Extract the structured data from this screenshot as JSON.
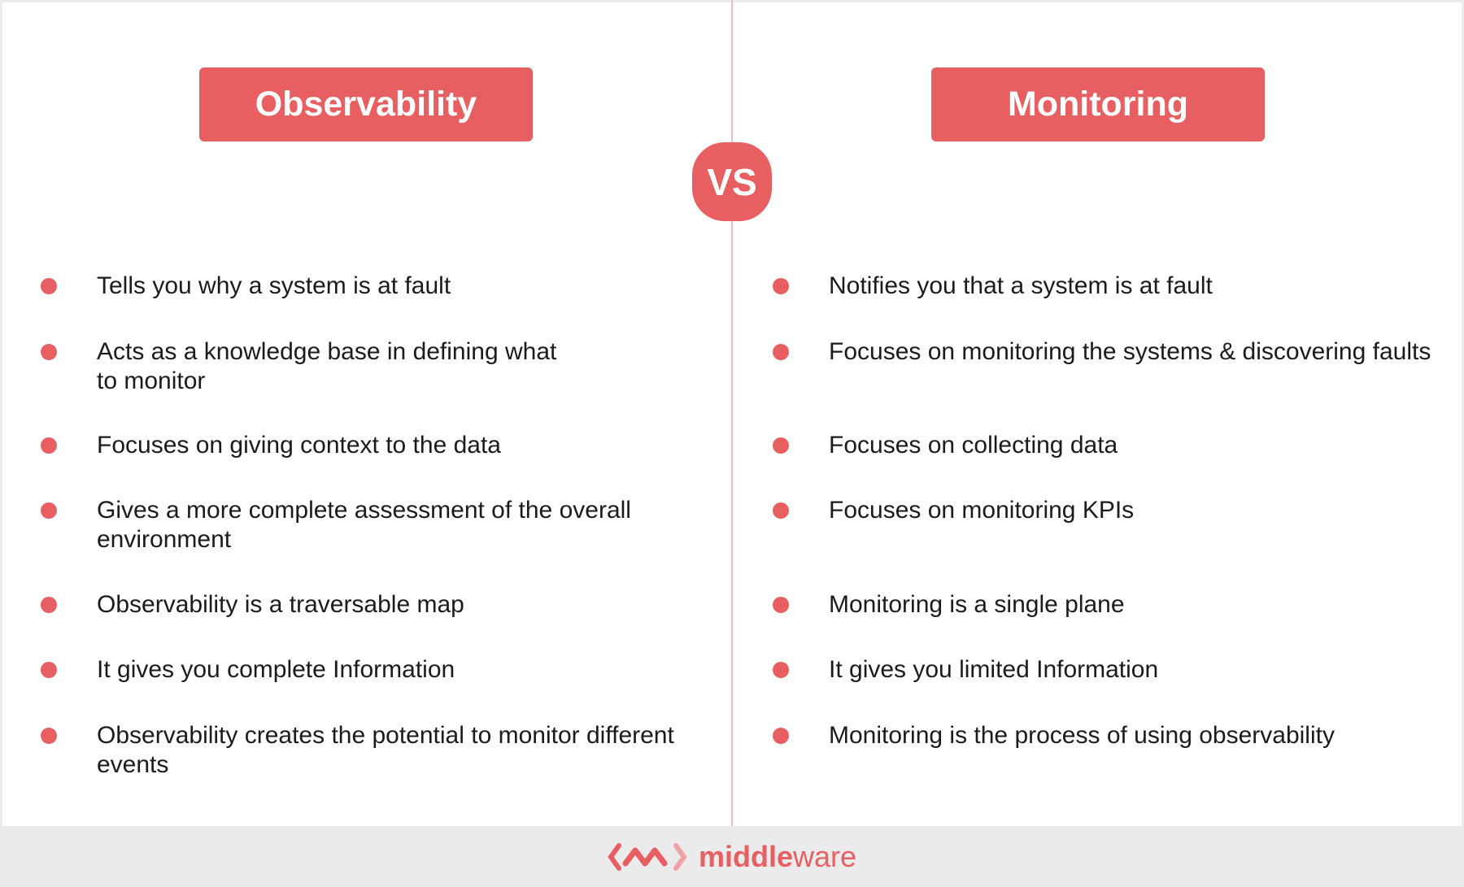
{
  "left": {
    "title": "Observability",
    "items": [
      "Tells you why a system is at fault",
      "Acts as a knowledge base in defining what\nto monitor",
      "Focuses on giving context to the data",
      "Gives a more complete assessment of the overall environment",
      "Observability is a traversable map",
      "It gives you complete Information",
      "Observability creates the potential to monitor different events"
    ]
  },
  "right": {
    "title": "Monitoring",
    "items": [
      "Notifies you that a system is at fault",
      "Focuses on monitoring the systems & discovering faults",
      "Focuses on collecting data",
      "Focuses on monitoring KPIs",
      "Monitoring is a single plane",
      "It gives you limited Information",
      "Monitoring is the process of using observability"
    ]
  },
  "vs_label": "VS",
  "footer": {
    "logo_bold": "middle",
    "logo_light": "ware"
  },
  "colors": {
    "accent": "#e85f62",
    "divider": "#f5b9bd",
    "footer_bg": "#ebebeb"
  }
}
